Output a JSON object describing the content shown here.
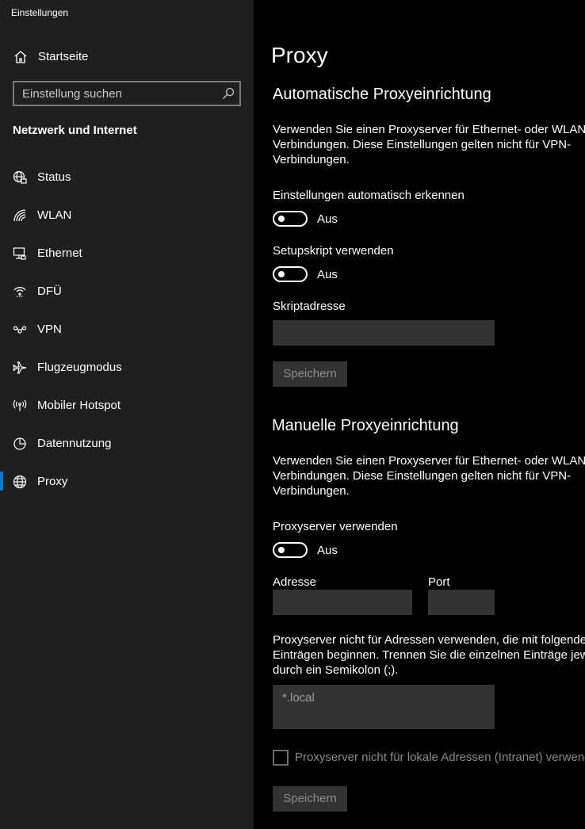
{
  "window": {
    "title": "Einstellungen"
  },
  "sidebar": {
    "home_label": "Startseite",
    "search_placeholder": "Einstellung suchen",
    "section_title": "Netzwerk und Internet",
    "items": [
      {
        "label": "Status",
        "icon": "globe-status-icon"
      },
      {
        "label": "WLAN",
        "icon": "wifi-icon"
      },
      {
        "label": "Ethernet",
        "icon": "ethernet-icon"
      },
      {
        "label": "DFÜ",
        "icon": "dialup-icon"
      },
      {
        "label": "VPN",
        "icon": "vpn-icon"
      },
      {
        "label": "Flugzeugmodus",
        "icon": "airplane-icon"
      },
      {
        "label": "Mobiler Hotspot",
        "icon": "hotspot-icon"
      },
      {
        "label": "Datennutzung",
        "icon": "data-usage-icon"
      },
      {
        "label": "Proxy",
        "icon": "globe-icon",
        "selected": true
      }
    ]
  },
  "main": {
    "title": "Proxy",
    "auto": {
      "heading": "Automatische Proxyeinrichtung",
      "description_line1": "Verwenden Sie einen Proxyserver für Ethernet- oder WLAN-",
      "description_line2": "Verbindungen. Diese Einstellungen gelten nicht für VPN-",
      "description_line3": "Verbindungen.",
      "detect_label": "Einstellungen automatisch erkennen",
      "detect_state": "Aus",
      "script_label": "Setupskript verwenden",
      "script_state": "Aus",
      "address_label": "Skriptadresse",
      "address_value": "",
      "save_label": "Speichern"
    },
    "manual": {
      "heading": "Manuelle Proxyeinrichtung",
      "description_line1": "Verwenden Sie einen Proxyserver für Ethernet- oder WLAN-",
      "description_line2": "Verbindungen. Diese Einstellungen gelten nicht für VPN-",
      "description_line3": "Verbindungen.",
      "use_proxy_label": "Proxyserver verwenden",
      "use_proxy_state": "Aus",
      "address_label": "Adresse",
      "address_value": "",
      "port_label": "Port",
      "port_value": "",
      "exceptions_line1": "Proxyserver nicht für Adressen verwenden, die mit folgenden",
      "exceptions_line2": "Einträgen beginnen. Trennen Sie die einzelnen Einträge jeweils",
      "exceptions_line3": "durch ein Semikolon (;).",
      "exceptions_placeholder": "*.local",
      "local_checkbox_label": "Proxyserver nicht für lokale Adressen (Intranet) verwenden",
      "save_label": "Speichern"
    }
  },
  "colors": {
    "accent": "#0078d7",
    "sidebar_bg": "#1f1f1f",
    "main_bg": "#000000",
    "field_bg": "#333333"
  }
}
